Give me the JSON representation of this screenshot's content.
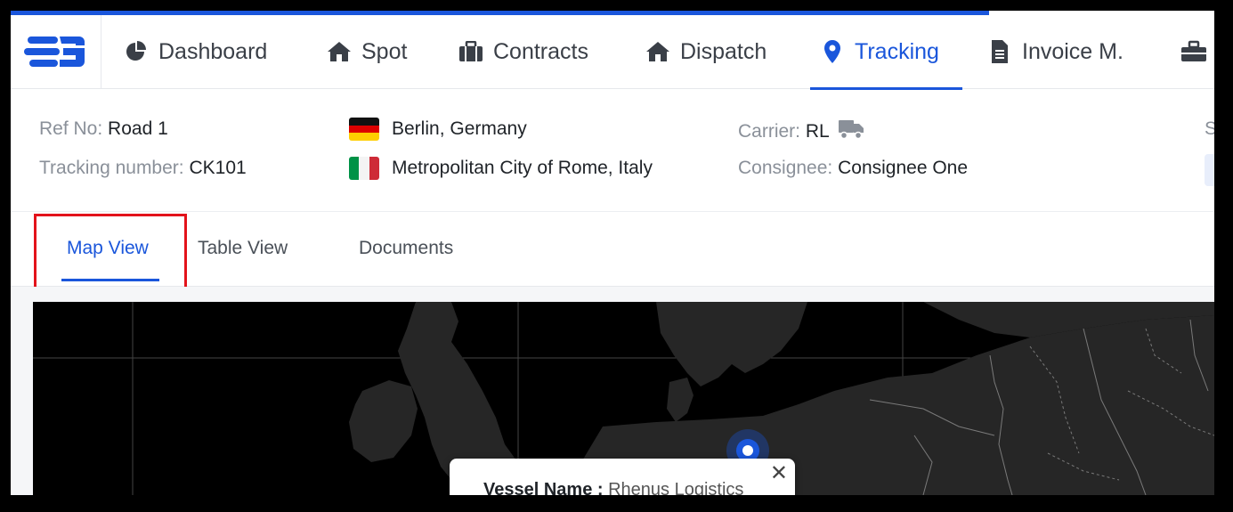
{
  "nav": {
    "items": [
      {
        "label": "Dashboard",
        "icon": "pie-chart-icon"
      },
      {
        "label": "Spot",
        "icon": "home-icon"
      },
      {
        "label": "Contracts",
        "icon": "briefcase-icon"
      },
      {
        "label": "Dispatch",
        "icon": "home-icon"
      },
      {
        "label": "Tracking",
        "icon": "map-pin-icon",
        "active": true
      },
      {
        "label": "Invoice M.",
        "icon": "document-icon"
      }
    ]
  },
  "shipment": {
    "ref_label": "Ref No:",
    "ref_value": "Road 1",
    "tracking_label": "Tracking number:",
    "tracking_value": "CK101",
    "origin": "Berlin, Germany",
    "destination": "Metropolitan City of Rome, Italy",
    "carrier_label": "Carrier:",
    "carrier_value": "RL",
    "consignee_label": "Consignee:",
    "consignee_value": "Consignee One",
    "cut_label": "S"
  },
  "tabs": [
    {
      "label": "Map View",
      "active": true
    },
    {
      "label": "Table View"
    },
    {
      "label": "Documents"
    }
  ],
  "map": {
    "popup": {
      "label": "Vessel Name :",
      "value": "Rhenus Logistics"
    }
  },
  "colors": {
    "accent": "#1a56db",
    "highlight": "#e3131b",
    "map": "#000000",
    "land": "#262626"
  }
}
